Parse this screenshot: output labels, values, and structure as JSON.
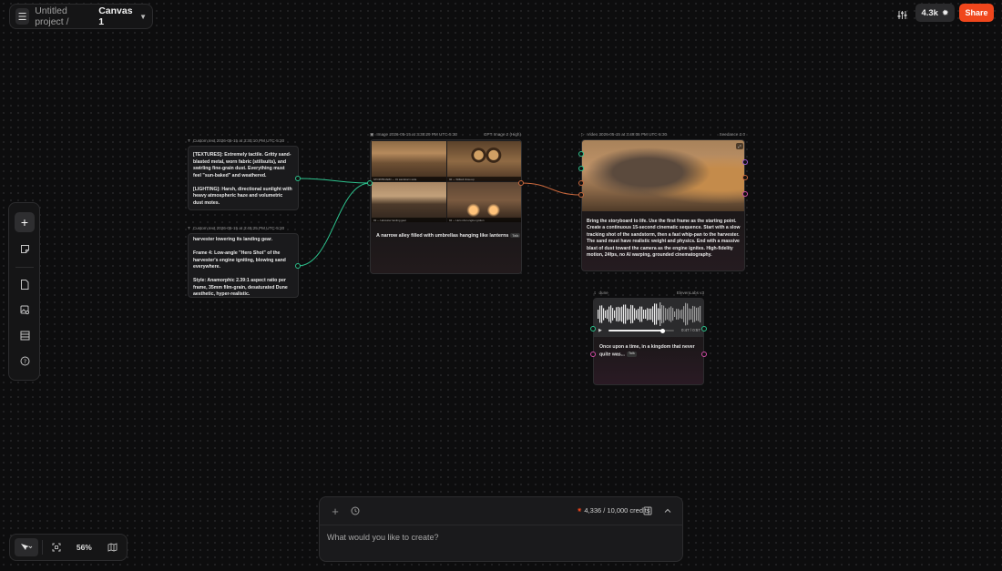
{
  "topbar": {
    "project_name": "Untitled project /",
    "canvas_name": "Canvas 1",
    "credits_badge": "4.3k",
    "share_label": "Share"
  },
  "zoom": {
    "level": "56%"
  },
  "nodes": {
    "text1": {
      "header": "Custom text 2026-05-15 at 3:30:10 PM UTC-5:30",
      "body": "[TEXTURES]: Extremely tactile. Gritty sand-blasted metal, worn fabric (stillsuits), and swirling fine-grain dust. Everything must feel \"sun-baked\" and weathered.\n\n[LIGHTING]: Harsh, directional sunlight with heavy atmospheric haze and volumetric dust motes."
    },
    "text2": {
      "header": "Custom text 2026-05-15 at 3:45:25 PM UTC-5:30",
      "body": "harvester lowering its landing gear.\n\nFrame 4: Low-angle \"Hero Shot\" of the harvester's engine igniting, blowing sand everywhere.\n\nStyle: Anamorphic 2.39:1 aspect ratio per frame, 35mm film-grain, desaturated Dune aesthetic, hyper-realistic."
    },
    "image": {
      "header": "Image 2026-05-15 at 3:38:29 PM UTC-5:30",
      "model": "GPT Image 2 (High)",
      "prompt": "A narrow alley filled with umbrellas hanging like lanterns",
      "tag": "Talk"
    },
    "video": {
      "header": "Video 2026-05-15 at 3:49:05 PM UTC-5:30",
      "model": "Seedance 2.0",
      "body": "Bring the storyboard to life. Use the first frame as the starting point. Create a continuous 15-second cinematic sequence. Start with a slow tracking shot of the sandstorm, then a fast whip-pan to the harvester. The sand must have realistic weight and physics. End with a massive blast of dust toward the camera as the engine ignites. High-fidelity motion, 24fps, no AI warping, grounded cinematography."
    },
    "audio": {
      "header": "dune",
      "model": "ElevenLabs v3",
      "time": "0:47 / 0:57",
      "prompt": "Once upon a time, in a kingdom that never quite was...",
      "tag": "Talk"
    }
  },
  "prompt_box": {
    "credits": "4,336 / 10,000 credits",
    "placeholder": "What would you like to create?"
  },
  "colors": {
    "accent": "#f0461c",
    "port_green": "#2dc28d",
    "port_orange": "#c8673c",
    "port_magenta": "#d24ca6"
  }
}
